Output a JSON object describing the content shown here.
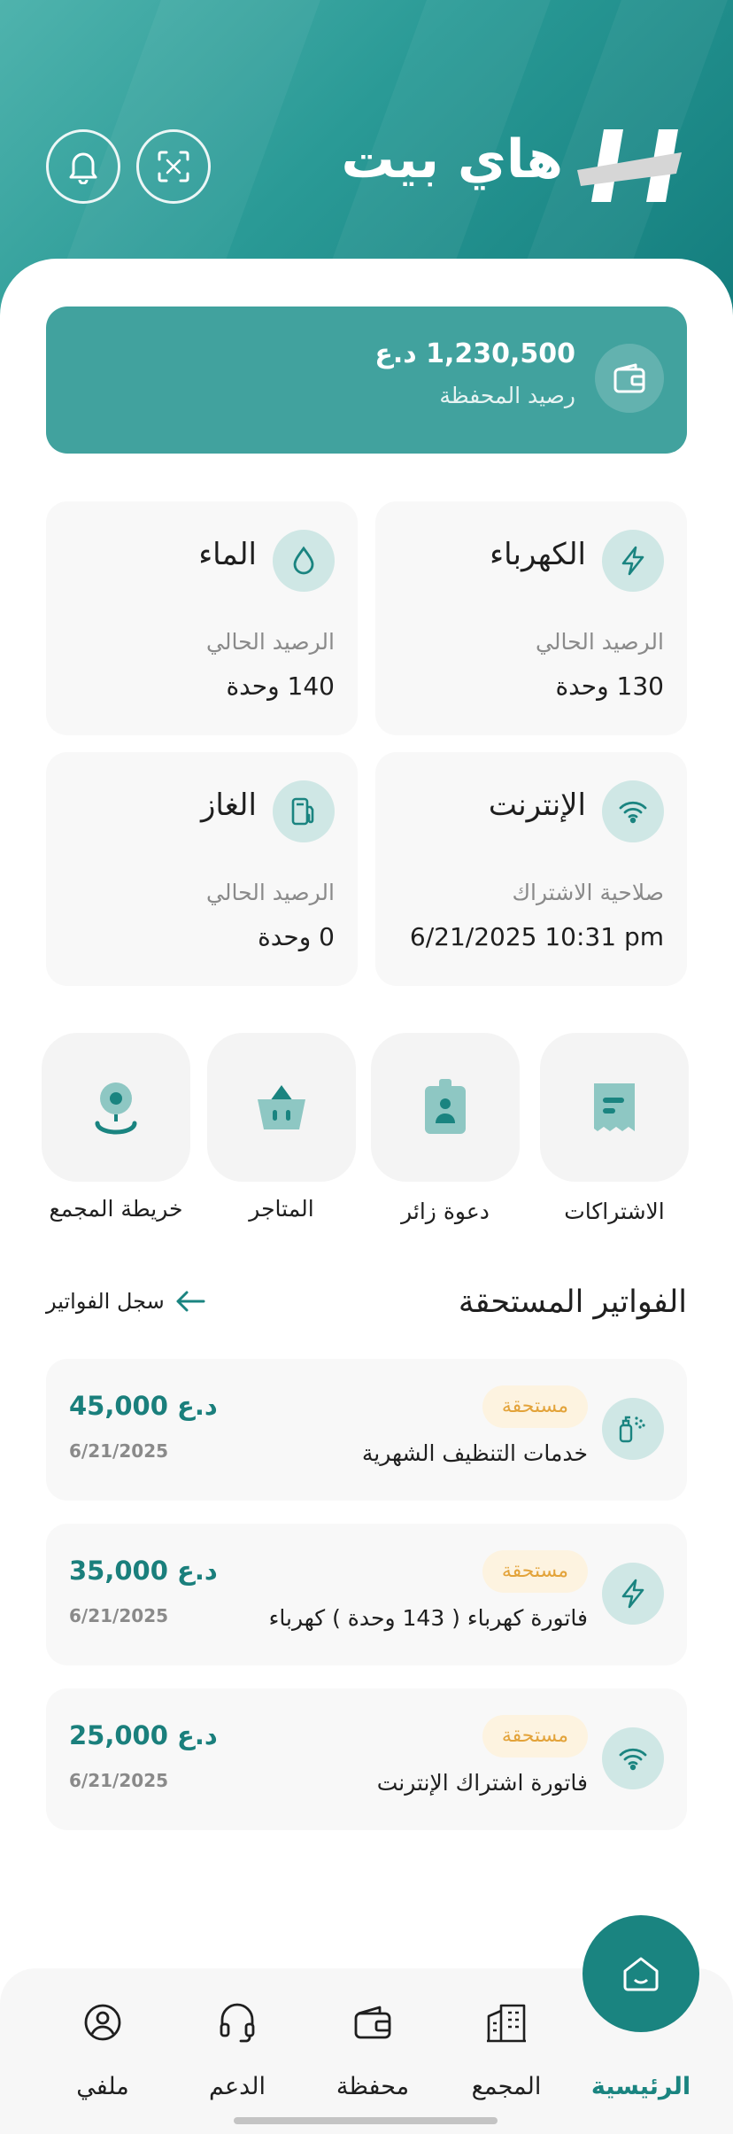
{
  "app": {
    "brand": "هاي بيت"
  },
  "colors": {
    "primary": "#1a8480",
    "wallet_card": "#41a29e",
    "icon_bg": "#cfe7e5",
    "badge_bg": "#fdf3e0",
    "badge_text": "#e3a33a"
  },
  "header": {
    "qr_icon": "qr-scan-icon",
    "bell_icon": "bell-icon"
  },
  "wallet": {
    "amount": "1,230,500 د.ع",
    "label": "رصيد المحفظة"
  },
  "utilities": [
    {
      "title": "الكهرباء",
      "icon": "lightning-icon",
      "label": "الرصيد الحالي",
      "value": "130 وحدة"
    },
    {
      "title": "الماء",
      "icon": "water-drop-icon",
      "label": "الرصيد الحالي",
      "value": "140 وحدة"
    },
    {
      "title": "الإنترنت",
      "icon": "wifi-icon",
      "label": "صلاحية الاشتراك",
      "value": "6/21/2025 10:31 pm"
    },
    {
      "title": "الغاز",
      "icon": "gas-pump-icon",
      "label": "الرصيد الحالي",
      "value": "0 وحدة"
    }
  ],
  "quick_actions": [
    {
      "label": "الاشتراكات",
      "icon": "receipt-icon"
    },
    {
      "label": "دعوة زائر",
      "icon": "visitor-badge-icon"
    },
    {
      "label": "المتاجر",
      "icon": "shopping-basket-icon"
    },
    {
      "label": "خريطة المجمع",
      "icon": "map-pin-icon"
    }
  ],
  "bills_section": {
    "title": "الفواتير المستحقة",
    "history_link": "سجل الفواتير"
  },
  "bills": [
    {
      "title": "خدمات التنظيف الشهرية",
      "status": "مستحقة",
      "amount": "45,000 د.ع",
      "date": "6/21/2025",
      "icon": "spray-bottle-icon"
    },
    {
      "title": "فاتورة كهرباء ( 143 وحدة ) كهرباء",
      "status": "مستحقة",
      "amount": "35,000 د.ع",
      "date": "6/21/2025",
      "icon": "lightning-icon"
    },
    {
      "title": "فاتورة اشتراك الإنترنت",
      "status": "مستحقة",
      "amount": "25,000 د.ع",
      "date": "6/21/2025",
      "icon": "wifi-icon"
    }
  ],
  "nav": {
    "items": [
      {
        "label": "الرئيسية",
        "icon": "home-icon",
        "active": true
      },
      {
        "label": "المجمع",
        "icon": "building-icon"
      },
      {
        "label": "محفظة",
        "icon": "wallet-icon"
      },
      {
        "label": "الدعم",
        "icon": "headset-icon"
      },
      {
        "label": "ملفي",
        "icon": "user-icon"
      }
    ]
  }
}
